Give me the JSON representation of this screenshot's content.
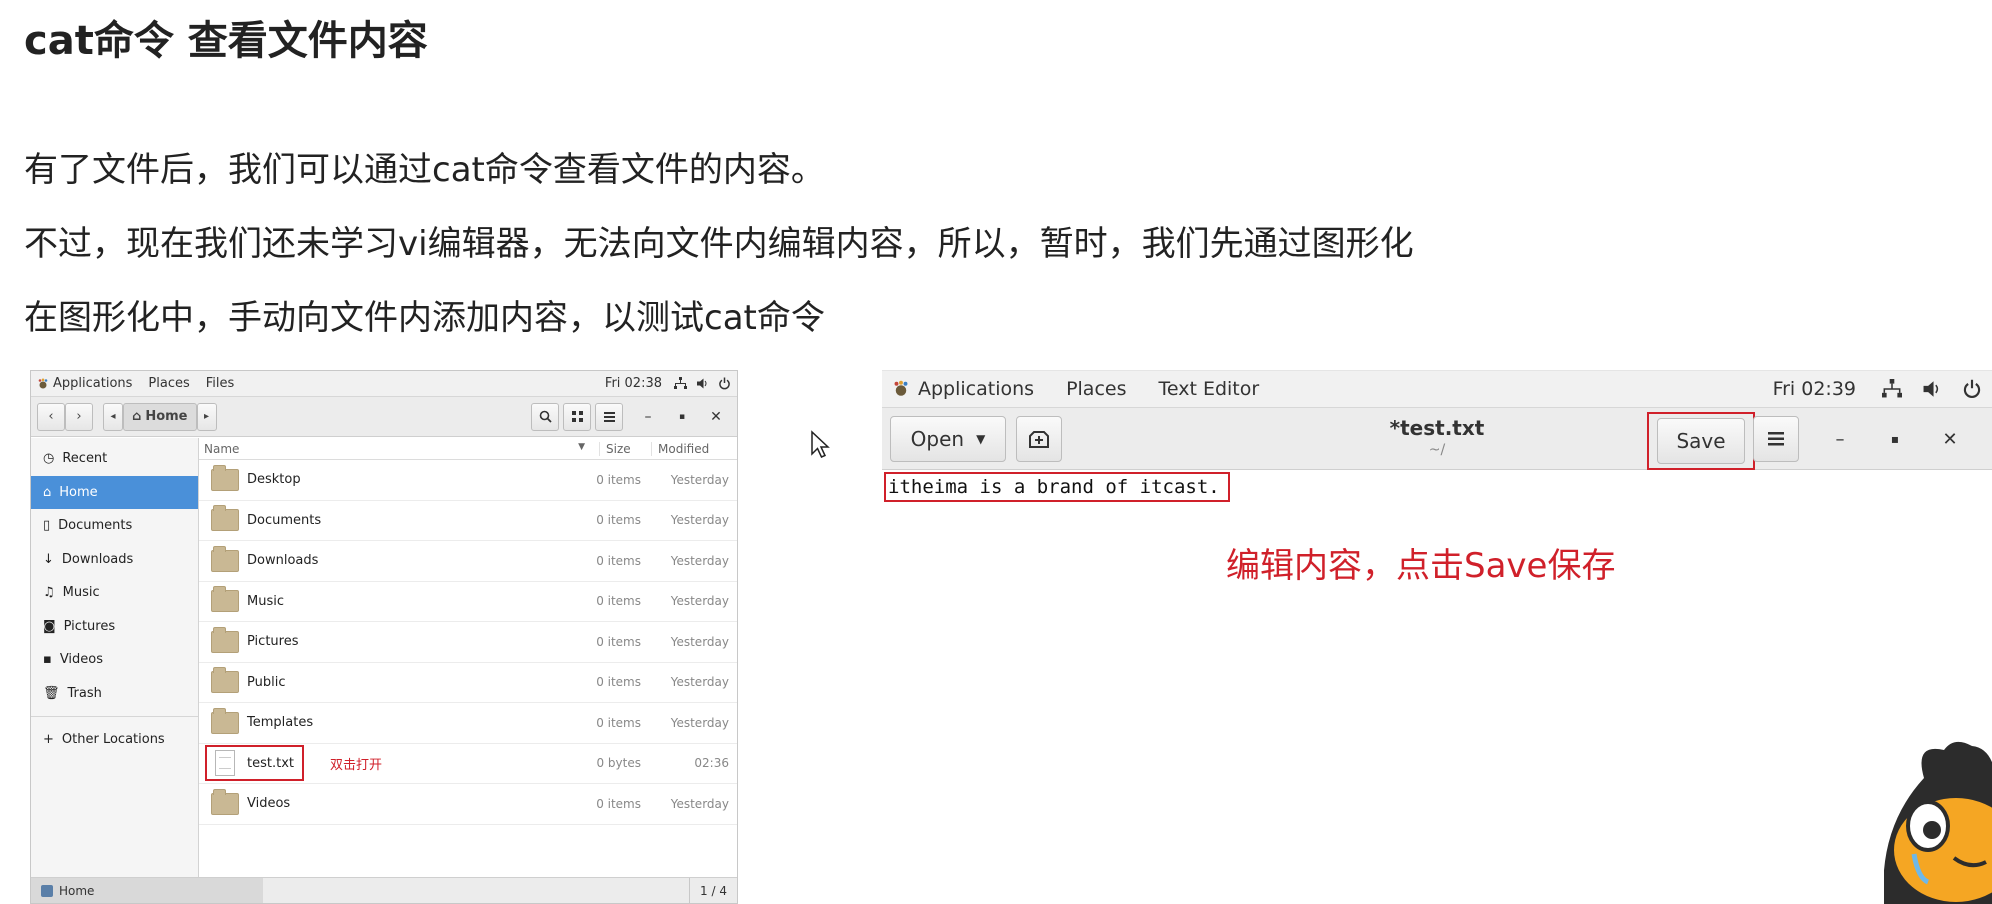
{
  "slide": {
    "title": "cat命令 查看文件内容",
    "line1": "有了文件后，我们可以通过cat命令查看文件的内容。",
    "line2": "不过，现在我们还未学习vi编辑器，无法向文件内编辑内容，所以，暂时，我们先通过图形化",
    "line3": "在图形化中，手动向文件内添加内容，以测试cat命令"
  },
  "file_manager": {
    "topbar": {
      "applications": "Applications",
      "places": "Places",
      "files": "Files",
      "clock": "Fri 02:38"
    },
    "path_home": "Home",
    "columns": {
      "name": "Name",
      "size": "Size",
      "modified": "Modified"
    },
    "sidebar": [
      {
        "label": "Recent",
        "icon": "clock-icon"
      },
      {
        "label": "Home",
        "icon": "home-icon"
      },
      {
        "label": "Documents",
        "icon": "document-icon"
      },
      {
        "label": "Downloads",
        "icon": "download-icon"
      },
      {
        "label": "Music",
        "icon": "music-icon"
      },
      {
        "label": "Pictures",
        "icon": "camera-icon"
      },
      {
        "label": "Videos",
        "icon": "video-icon"
      },
      {
        "label": "Trash",
        "icon": "trash-icon"
      }
    ],
    "other_locations": "Other Locations",
    "files": [
      {
        "name": "Desktop",
        "size": "0 items",
        "modified": "Yesterday"
      },
      {
        "name": "Documents",
        "size": "0 items",
        "modified": "Yesterday"
      },
      {
        "name": "Downloads",
        "size": "0 items",
        "modified": "Yesterday"
      },
      {
        "name": "Music",
        "size": "0 items",
        "modified": "Yesterday"
      },
      {
        "name": "Pictures",
        "size": "0 items",
        "modified": "Yesterday"
      },
      {
        "name": "Public",
        "size": "0 items",
        "modified": "Yesterday"
      },
      {
        "name": "Templates",
        "size": "0 items",
        "modified": "Yesterday"
      },
      {
        "name": "test.txt",
        "size": "0 bytes",
        "modified": "02:36"
      },
      {
        "name": "Videos",
        "size": "0 items",
        "modified": "Yesterday"
      }
    ],
    "hint": "双击打开",
    "status_left": "Home",
    "status_right": "1 / 4"
  },
  "text_editor": {
    "topbar": {
      "applications": "Applications",
      "places": "Places",
      "text_editor": "Text Editor",
      "clock": "Fri 02:39"
    },
    "open_label": "Open",
    "title": "*test.txt",
    "subtitle": "~/",
    "save_label": "Save",
    "content": "itheima is a brand of itcast.",
    "note": "编辑内容，点击Save保存"
  },
  "colors": {
    "accent_red": "#d0202a",
    "selection_blue": "#4a90d9"
  }
}
